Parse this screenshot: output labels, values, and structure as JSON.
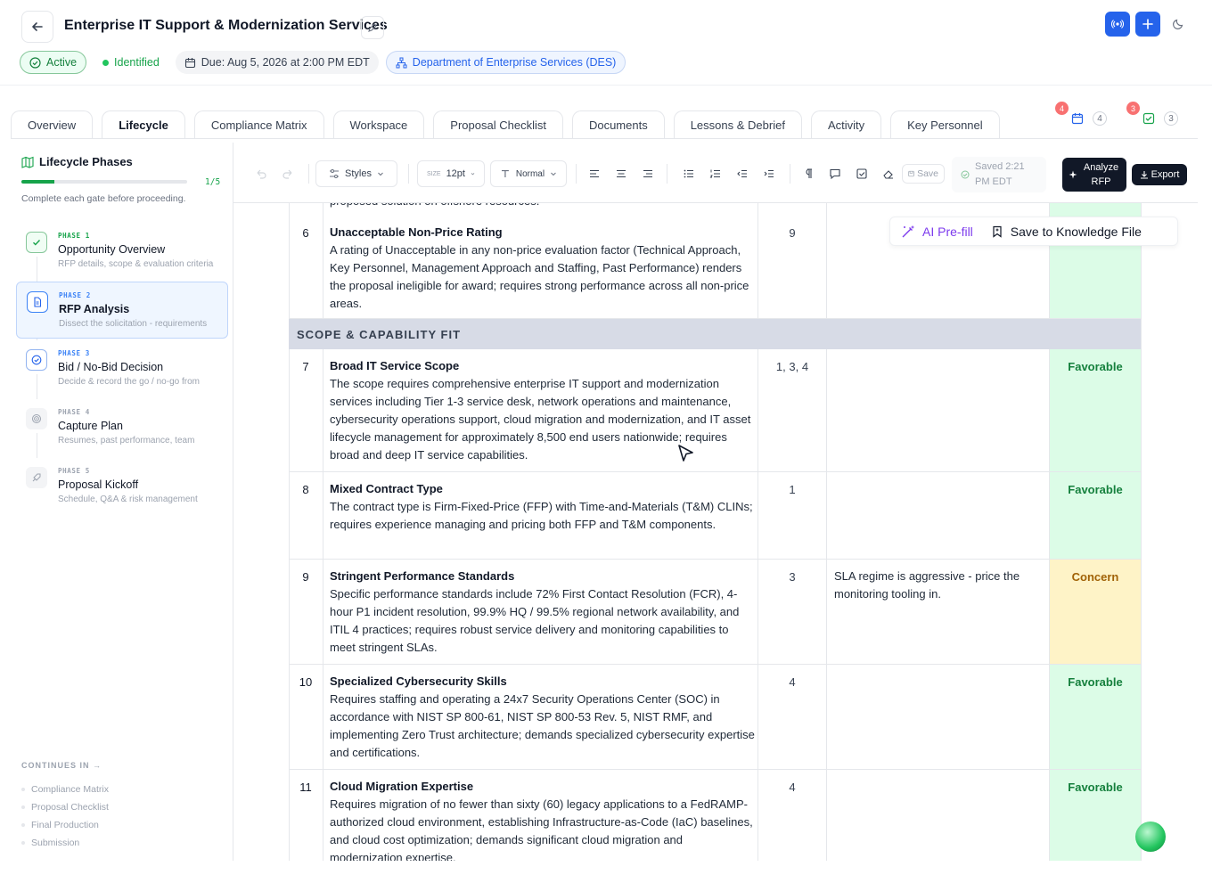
{
  "header": {
    "title": "Enterprise IT Support & Modernization Services",
    "status": "Active",
    "stage": "Identified",
    "due": "Due: Aug 5, 2026 at 2:00 PM EDT",
    "department": "Department of Enterprise Services (DES)"
  },
  "tabs": [
    "Overview",
    "Lifecycle",
    "Compliance Matrix",
    "Workspace",
    "Proposal Checklist",
    "Documents",
    "Lessons & Debrief",
    "Activity",
    "Key Personnel"
  ],
  "active_tab": "Lifecycle",
  "counters": [
    {
      "alert": "4",
      "count": "4",
      "icon": "calendar-icon"
    },
    {
      "alert": "3",
      "count": "3",
      "icon": "check-square-icon"
    }
  ],
  "sidebar": {
    "title": "Lifecycle Phases",
    "progress_label": "1/5",
    "progress_fraction": 0.2,
    "hint": "Complete each gate before proceeding.",
    "phases": [
      {
        "label": "PHASE 1",
        "name": "Opportunity Overview",
        "desc": "RFP details, scope & evaluation criteria"
      },
      {
        "label": "PHASE 2",
        "name": "RFP Analysis",
        "desc": "Dissect the solicitation - requirements"
      },
      {
        "label": "PHASE 3",
        "name": "Bid / No-Bid Decision",
        "desc": "Decide & record the go / no-go from"
      },
      {
        "label": "PHASE 4",
        "name": "Capture Plan",
        "desc": "Resumes, past performance, team"
      },
      {
        "label": "PHASE 5",
        "name": "Proposal Kickoff",
        "desc": "Schedule, Q&A & risk management"
      }
    ],
    "continues_label": "CONTINUES IN →",
    "continues": [
      "Compliance Matrix",
      "Proposal Checklist",
      "Final Production",
      "Submission"
    ]
  },
  "toolbar": {
    "styles": "Styles",
    "size_label": "SIZE",
    "size": "12pt",
    "paragraph": "Normal",
    "save": "Save",
    "saved": "Saved 2:21 PM EDT",
    "analyze": "Analyze RFP",
    "export": "Export"
  },
  "float_bar": {
    "ai": "AI Pre-fill",
    "save": "Save to Knowledge File"
  },
  "document": {
    "top_fragment": "proposed solution on offshore resources.",
    "section": "SCOPE & CAPABILITY FIT",
    "rows": [
      {
        "num": "6",
        "title": "Unacceptable Non-Price Rating",
        "text": "A rating of Unacceptable in any non-price evaluation factor (Technical Approach, Key Personnel, Management Approach and Staffing, Past Performance) renders the proposal ineligible for award; requires strong performance across all non-price areas.",
        "ref": "9",
        "note": "",
        "status": ""
      },
      {
        "num": "7",
        "title": "Broad IT Service Scope",
        "text": "The scope requires comprehensive enterprise IT support and modernization services including Tier 1-3 service desk, network operations and maintenance, cybersecurity operations support, cloud migration and modernization, and IT asset lifecycle management for approximately 8,500 end users nationwide; requires broad and deep IT service capabilities.",
        "ref": "1, 3, 4",
        "note": "",
        "status": "Favorable"
      },
      {
        "num": "8",
        "title": "Mixed Contract Type",
        "text": "The contract type is Firm-Fixed-Price (FFP) with Time-and-Materials (T&M) CLINs; requires experience managing and pricing both FFP and T&M components.",
        "ref": "1",
        "note": "",
        "status": "Favorable"
      },
      {
        "num": "9",
        "title": "Stringent Performance Standards",
        "text": "Specific performance standards include 72% First Contact Resolution (FCR), 4-hour P1 incident resolution, 99.9% HQ / 99.5% regional network availability, and ITIL 4 practices; requires robust service delivery and monitoring capabilities to meet stringent SLAs.",
        "ref": "3",
        "note": "SLA regime is aggressive - price the monitoring tooling in.",
        "status": "Concern"
      },
      {
        "num": "10",
        "title": "Specialized Cybersecurity Skills",
        "text": "Requires staffing and operating a 24x7 Security Operations Center (SOC) in accordance with NIST SP 800-61, NIST SP 800-53 Rev. 5, NIST RMF, and implementing Zero Trust architecture; demands specialized cybersecurity expertise and certifications.",
        "ref": "4",
        "note": "",
        "status": "Favorable"
      },
      {
        "num": "11",
        "title": "Cloud Migration Expertise",
        "text": "Requires migration of no fewer than sixty (60) legacy applications to a FedRAMP-authorized cloud environment, establishing Infrastructure-as-Code (IaC) baselines, and cloud cost optimization; demands significant cloud migration and modernization expertise.",
        "ref": "4",
        "note": "",
        "status": "Favorable"
      }
    ]
  },
  "colors": {
    "accent": "#2563eb",
    "favorable_bg": "#dcfce7",
    "favorable_text": "#15803d",
    "concern_bg": "#fef3c7",
    "concern_text": "#a16207",
    "section_bg": "#d7dbe6"
  }
}
